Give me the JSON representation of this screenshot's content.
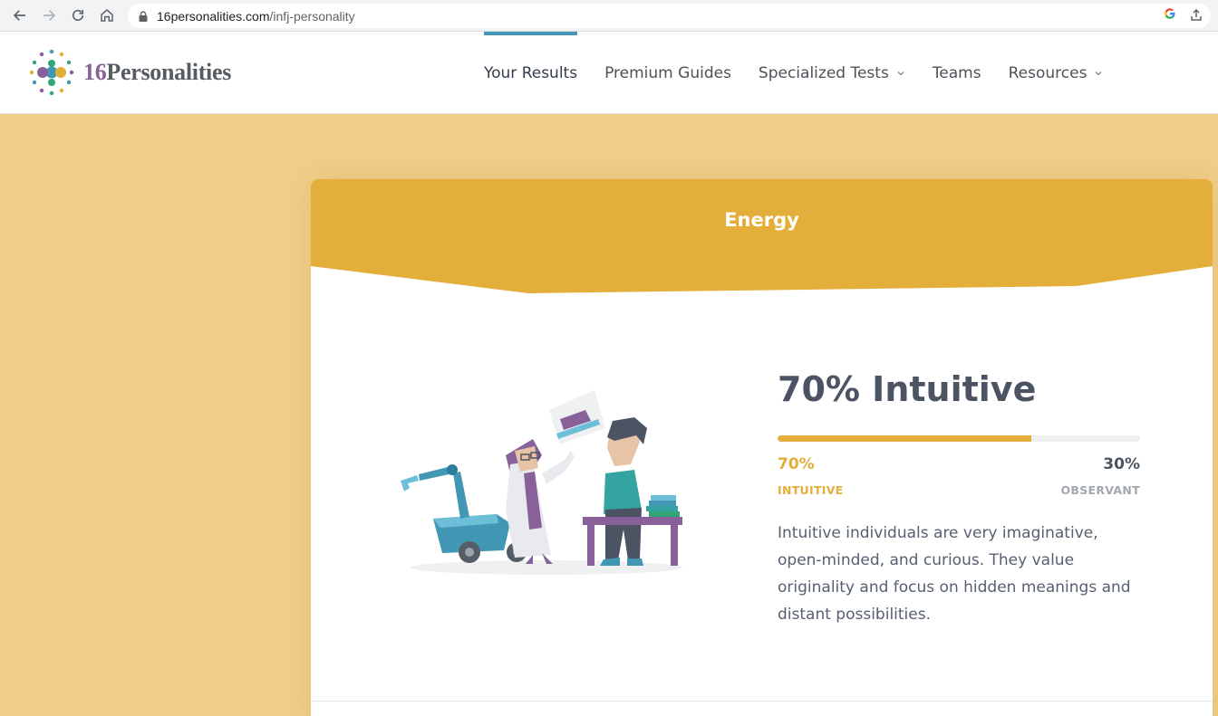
{
  "browser": {
    "url_domain": "16personalities.com",
    "url_path": "/infj-personality"
  },
  "site": {
    "logo_number": "16",
    "logo_word": "Personalities",
    "nav": [
      {
        "label": "Your Results",
        "active": true,
        "dropdown": false
      },
      {
        "label": "Premium Guides",
        "active": false,
        "dropdown": false
      },
      {
        "label": "Specialized Tests",
        "active": false,
        "dropdown": true
      },
      {
        "label": "Teams",
        "active": false,
        "dropdown": false
      },
      {
        "label": "Resources",
        "active": false,
        "dropdown": true
      }
    ]
  },
  "trait": {
    "section_title": "Energy",
    "result_title": "70% Intuitive",
    "primary_percent_value": 70,
    "primary_percent": "70%",
    "primary_label": "INTUITIVE",
    "secondary_percent": "30%",
    "secondary_label": "OBSERVANT",
    "description": "Intuitive individuals are very imaginative, open-minded, and curious. They value originality and focus on hidden meanings and distant possibilities."
  },
  "colors": {
    "accent": "#e4ae3a",
    "background": "#f0cf8a",
    "nav_active": "#4298b4",
    "heading": "#4c5463"
  }
}
